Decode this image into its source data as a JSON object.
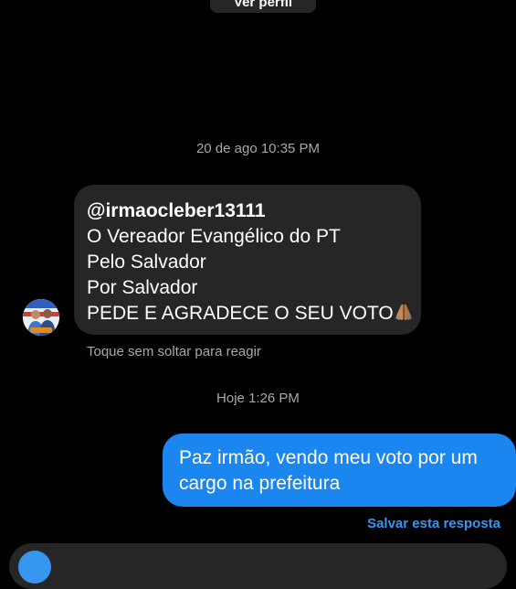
{
  "header": {
    "view_profile_label": "Ver perfil"
  },
  "thread": {
    "timestamp_1": "20 de ago 10:35 PM",
    "incoming_message": {
      "lines": [
        "@irmaocleber13111",
        "O Vereador Evangélico do PT",
        "Pelo Salvador",
        "Por Salvador",
        "PEDE E AGRADECE O SEU VOTO"
      ],
      "emoji": "folded-hands-emoji"
    },
    "reaction_hint": "Toque sem soltar para reagir",
    "timestamp_2": "Hoje 1:26 PM",
    "outgoing_message": {
      "lines": [
        "Paz irmão, vendo meu voto por um",
        "cargo na prefeitura"
      ]
    },
    "save_reply_label": "Salvar esta resposta"
  },
  "colors": {
    "background": "#000000",
    "incoming_bubble": "#262626",
    "outgoing_bubble": "#1b86f0",
    "link": "#3897f0",
    "muted_text": "#a8a8a8"
  }
}
